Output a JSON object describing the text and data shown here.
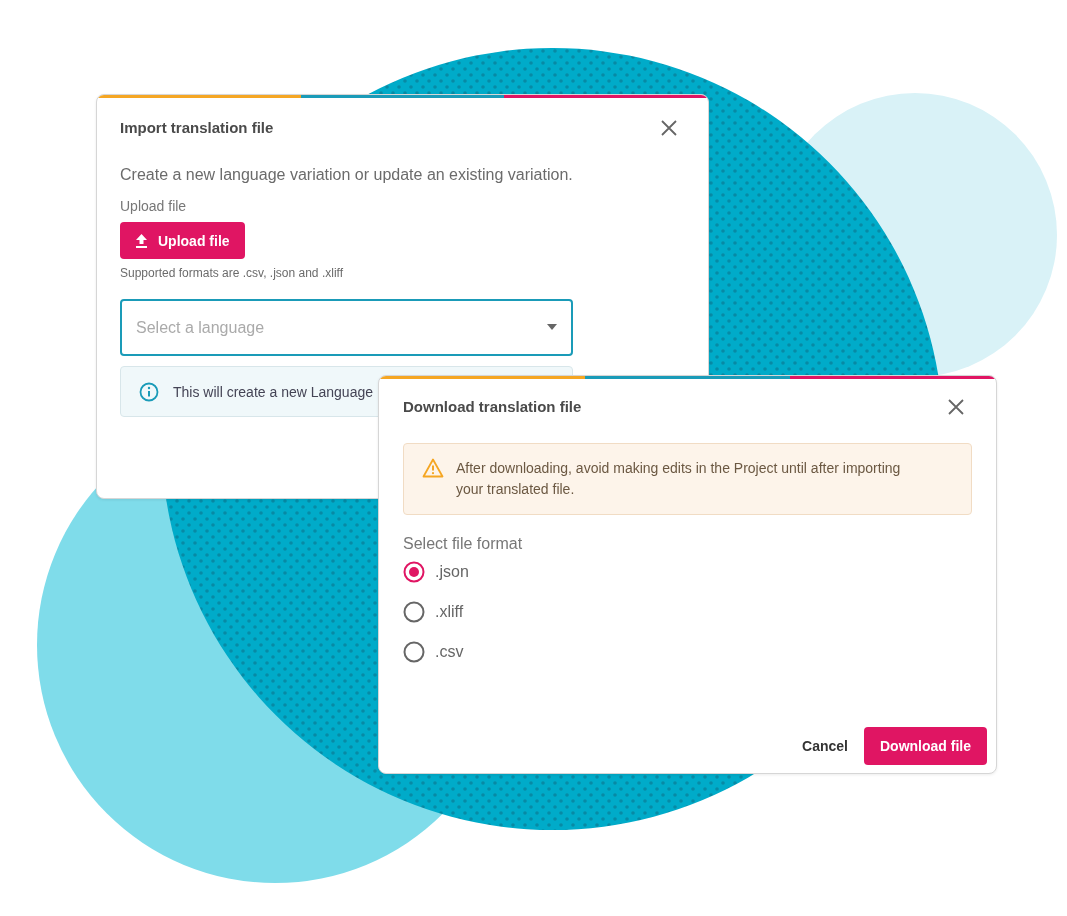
{
  "import_dialog": {
    "title": "Import translation file",
    "description": "Create a new language variation or update an existing variation.",
    "upload_label": "Upload file",
    "upload_button": "Upload file",
    "formats_hint": "Supported formats are .csv, .json and .xliff",
    "language_select": {
      "placeholder": "Select a language"
    },
    "info": "This will create a new Language"
  },
  "download_dialog": {
    "title": "Download translation file",
    "warning": "After downloading, avoid making edits in the Project until after importing your translated file.",
    "format_label": "Select file format",
    "formats": [
      {
        "label": ".json",
        "selected": true
      },
      {
        "label": ".xliff",
        "selected": false
      },
      {
        "label": ".csv",
        "selected": false
      }
    ],
    "buttons": [
      {
        "label": "Cancel",
        "kind": "secondary"
      },
      {
        "label": "Download file",
        "kind": "primary"
      }
    ]
  }
}
